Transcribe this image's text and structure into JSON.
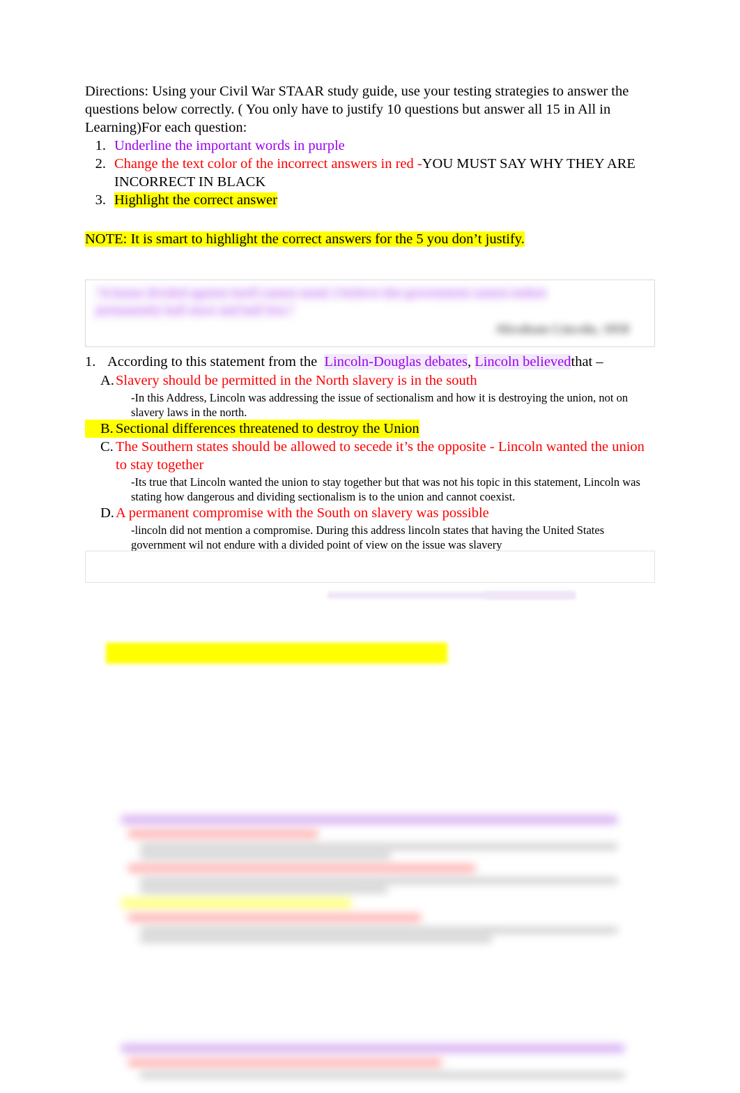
{
  "document": {
    "directions": {
      "intro": "Directions: Using your Civil War STAAR study guide, use your testing strategies to answer the questions below correctly. ( You only have to justify 10 questions but answer all 15 in All in Learning)",
      "intro_tail": "For each question:",
      "steps": [
        {
          "number": "1.",
          "text": "Underline the important words in purple",
          "color": "#9900EE",
          "highlight": false
        },
        {
          "number": "2.",
          "text_red": "Change the text color of the incorrect answers in red -",
          "text_black": "YOU MUST SAY WHY THEY ARE INCORRECT IN BLACK",
          "color": "#FF0000",
          "highlight": false
        },
        {
          "number": "3.",
          "text": "Highlight the correct answer",
          "color": "#000000",
          "highlight": true
        }
      ]
    },
    "note": "NOTE: It is smart to highlight the correct answers for the 5 you don’t justify.",
    "quote_box": {
      "line1": "\"A house divided against itself cannot stand. I believe this government cannot endure",
      "line2": "permanently half slave and half free.\"",
      "attribution": "Abraham Lincoln, 1858"
    },
    "questions": [
      {
        "number": "1.",
        "stem_lead": "According to this statement from the",
        "stem_purple_1": "Lincoln-Douglas debates",
        "stem_comma": ",",
        "stem_purple_2": "Lincoln believed",
        "stem_tail": "that –",
        "choices": [
          {
            "letter": "A.",
            "text": "Slavery should be permitted in the North slavery is in the south",
            "color": "#FF0000",
            "highlight": false,
            "justification": "-In this Address, Lincoln was addressing the issue of sectionalism and how it is destroying the union, not on slavery laws in the north."
          },
          {
            "letter": "B.",
            "text": "Sectional differences threatened to destroy the Union",
            "color": "#000000",
            "highlight": true,
            "justification": ""
          },
          {
            "letter": "C.",
            "text": "The Southern states should be allowed to secede it’s the opposite - Lincoln wanted the union to stay together",
            "color": "#FF0000",
            "highlight": false,
            "justification": "-Its true that Lincoln wanted the union to stay together but that was not his topic in this statement, Lincoln was stating how dangerous and dividing sectionalism is to the union and cannot coexist."
          },
          {
            "letter": "D.",
            "text": "A permanent compromise with the South on slavery was possible",
            "color": "#FF0000",
            "highlight": false,
            "justification": "-lincoln did not mention a compromise. During this address lincoln states that having the United States government wil not endure with a divided point of view on the issue was slavery"
          }
        ]
      }
    ],
    "redacted_sections": [
      {
        "name": "question-2-redacted",
        "note": "blurred content"
      },
      {
        "name": "question-3-redacted",
        "note": "blurred content"
      },
      {
        "name": "question-4-redacted",
        "note": "blurred content"
      }
    ],
    "colors": {
      "purple": "#9900EE",
      "red": "#FF0000",
      "highlight_yellow": "#FFFF00",
      "text_black": "#000000",
      "box_border": "#d9d9d9",
      "page_background": "#FFFFFF"
    }
  }
}
